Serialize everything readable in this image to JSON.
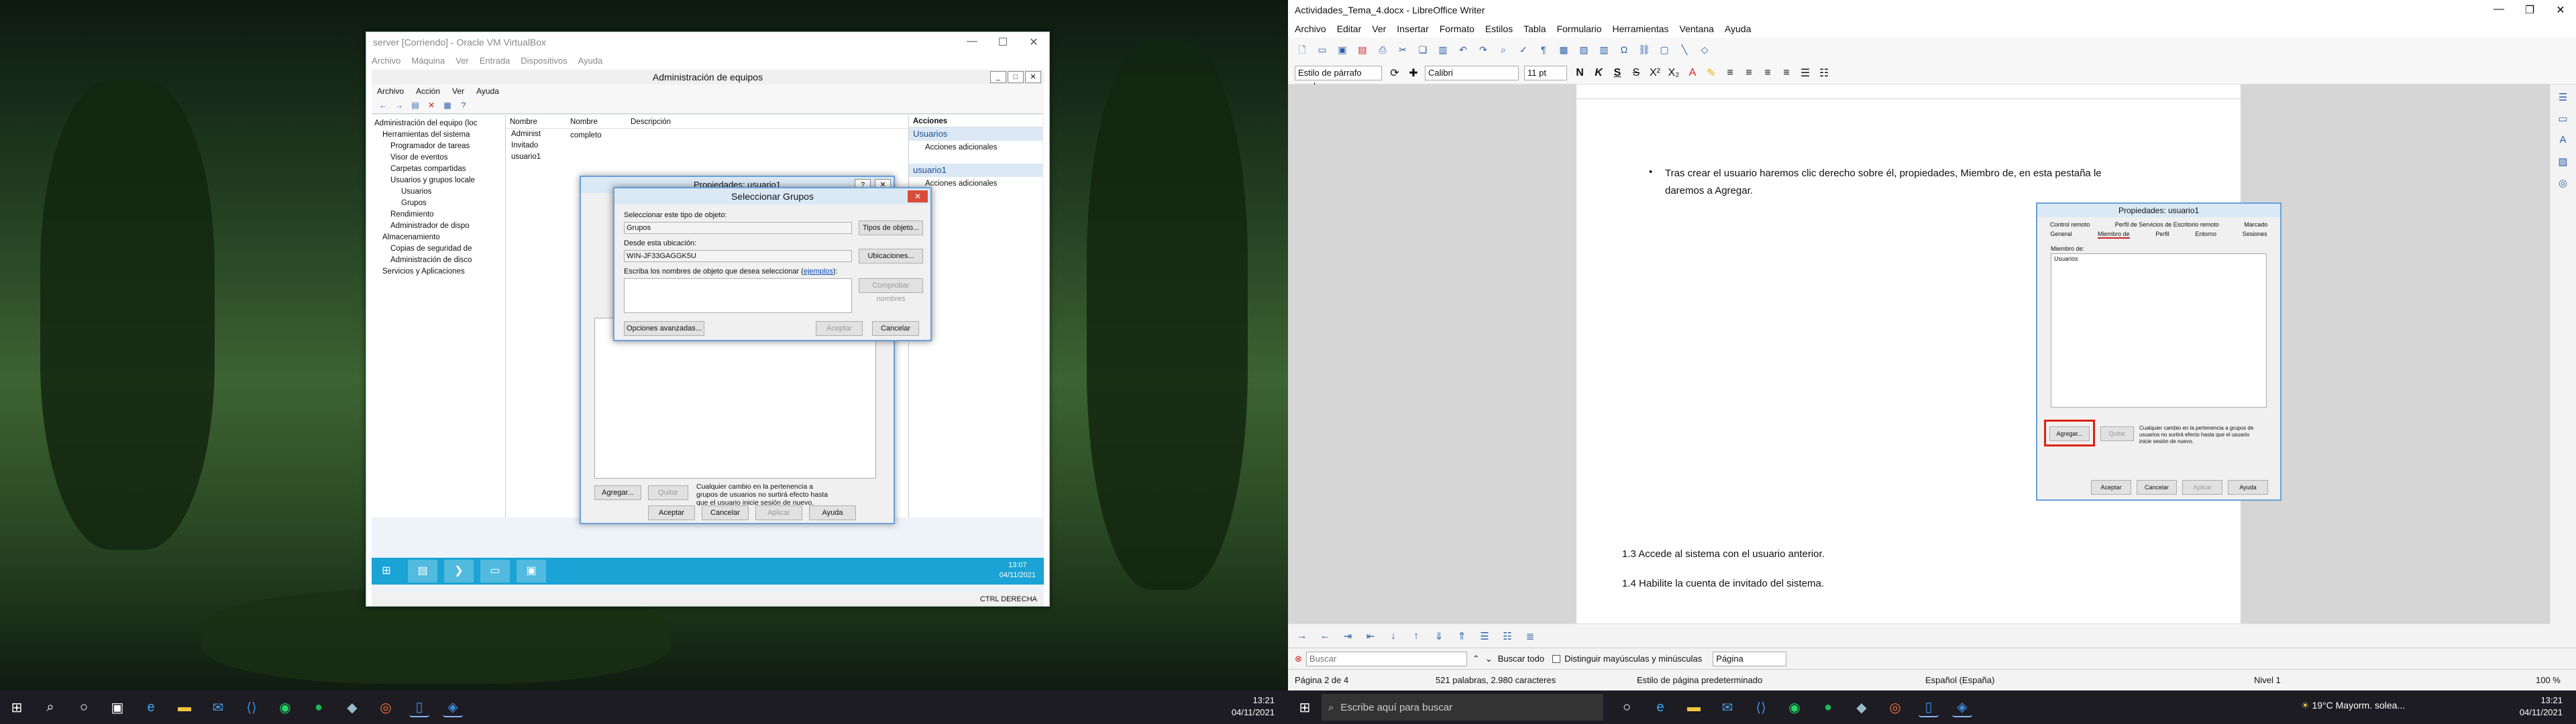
{
  "left_monitor": {
    "vbox": {
      "title": "server [Corriendo] - Oracle VM VirtualBox",
      "menu": [
        "Archivo",
        "Máquina",
        "Ver",
        "Entrada",
        "Dispositivos",
        "Ayuda"
      ],
      "status_host_key": "CTRL DERECHA"
    },
    "mmc": {
      "title": "Administración de equipos",
      "menu": [
        "Archivo",
        "Acción",
        "Ver",
        "Ayuda"
      ],
      "tree": [
        "Administración del equipo (loc",
        "Herramientas del sistema",
        "Programador de tareas",
        "Visor de eventos",
        "Carpetas compartidas",
        "Usuarios y grupos locale",
        "Usuarios",
        "Grupos",
        "Rendimiento",
        "Administrador de dispo",
        "Almacenamiento",
        "Copias de seguridad de",
        "Administración de disco",
        "Servicios y Aplicaciones"
      ],
      "list_headers": [
        "Nombre",
        "Nombre completo",
        "Descripción"
      ],
      "list_items": [
        "Administ",
        "Invitado",
        "usuario1"
      ],
      "actions": {
        "header": "Acciones",
        "section1": "Usuarios",
        "section1_item": "Acciones adicionales",
        "section2": "usuario1",
        "section2_item": "Acciones adicionales"
      }
    },
    "props": {
      "title": "Propiedades: usuario1",
      "add": "Agregar...",
      "remove": "Quitar",
      "note": "Cualquier cambio en la pertenencia a grupos de usuarios no surtirá efecto hasta que el usuario inicie sesión de nuevo.",
      "ok": "Aceptar",
      "cancel": "Cancelar",
      "apply": "Aplicar",
      "help": "Ayuda"
    },
    "select_groups": {
      "title": "Seleccionar Grupos",
      "type_label": "Seleccionar este tipo de objeto:",
      "type_value": "Grupos",
      "type_button": "Tipos de objeto...",
      "loc_label": "Desde esta ubicación:",
      "loc_value": "WIN-JF33GAGGK5U",
      "loc_button": "Ubicaciones...",
      "names_label": "Escriba los nombres de objeto que desea seleccionar",
      "examples_link": "ejemplos",
      "check_button": "Comprobar nombres",
      "advanced_button": "Opciones avanzadas...",
      "ok": "Aceptar",
      "cancel": "Cancelar"
    },
    "vm_clock_time": "13:07",
    "vm_clock_date": "04/11/2021",
    "taskbar_time": "13:21",
    "taskbar_date": "04/11/2021"
  },
  "right_monitor": {
    "title": "Actividades_Tema_4.docx - LibreOffice Writer",
    "menu": [
      "Archivo",
      "Editar",
      "Ver",
      "Insertar",
      "Formato",
      "Estilos",
      "Tabla",
      "Formulario",
      "Herramientas",
      "Ventana",
      "Ayuda"
    ],
    "para_style": "Estilo de párrafo prede",
    "font": "Calibri",
    "size": "11 pt",
    "doc": {
      "bullet": "Tras crear el usuario haremos clic derecho sobre él, propiedades, Miembro de, en esta pestaña le daremos a Agregar.",
      "embed_title": "Propiedades: usuario1",
      "embed_tabs_row1": [
        "Control remoto",
        "Perfil de Servicios de Escritorio remoto",
        "Marcado"
      ],
      "embed_tabs_row2": [
        "General",
        "Miembro de",
        "Perfil",
        "Entorno",
        "Sesiones"
      ],
      "embed_member_label": "Miembro de:",
      "embed_member_item": "Usuarios",
      "embed_add": "Agregar...",
      "embed_remove": "Quitar",
      "embed_note": "Cualquier cambio en la pertenencia a grupos de usuarios no surtirá efecto hasta que el usuario inicie sesión de nuevo.",
      "embed_ok": "Aceptar",
      "embed_cancel": "Cancelar",
      "embed_apply": "Aplicar",
      "embed_help": "Ayuda",
      "line_13": "1.3 Accede al sistema con el usuario anterior.",
      "line_14": "1.4 Habilite la cuenta de invitado del sistema."
    },
    "find": {
      "placeholder": "Buscar",
      "find_all": "Buscar todo",
      "match_case": "Distinguir mayúsculas y minúsculas",
      "scope": "Página"
    },
    "status": {
      "page": "Página 2 de 4",
      "words": "521 palabras, 2.980 caracteres",
      "style": "Estilo de página predeterminado",
      "lang": "Español (España)",
      "level": "Nivel 1",
      "zoom": "100 %"
    },
    "taskbar": {
      "search": "Escribe aquí para buscar",
      "weather": "19°C  Mayorm. solea...",
      "time": "13:21",
      "date": "04/11/2021"
    }
  }
}
